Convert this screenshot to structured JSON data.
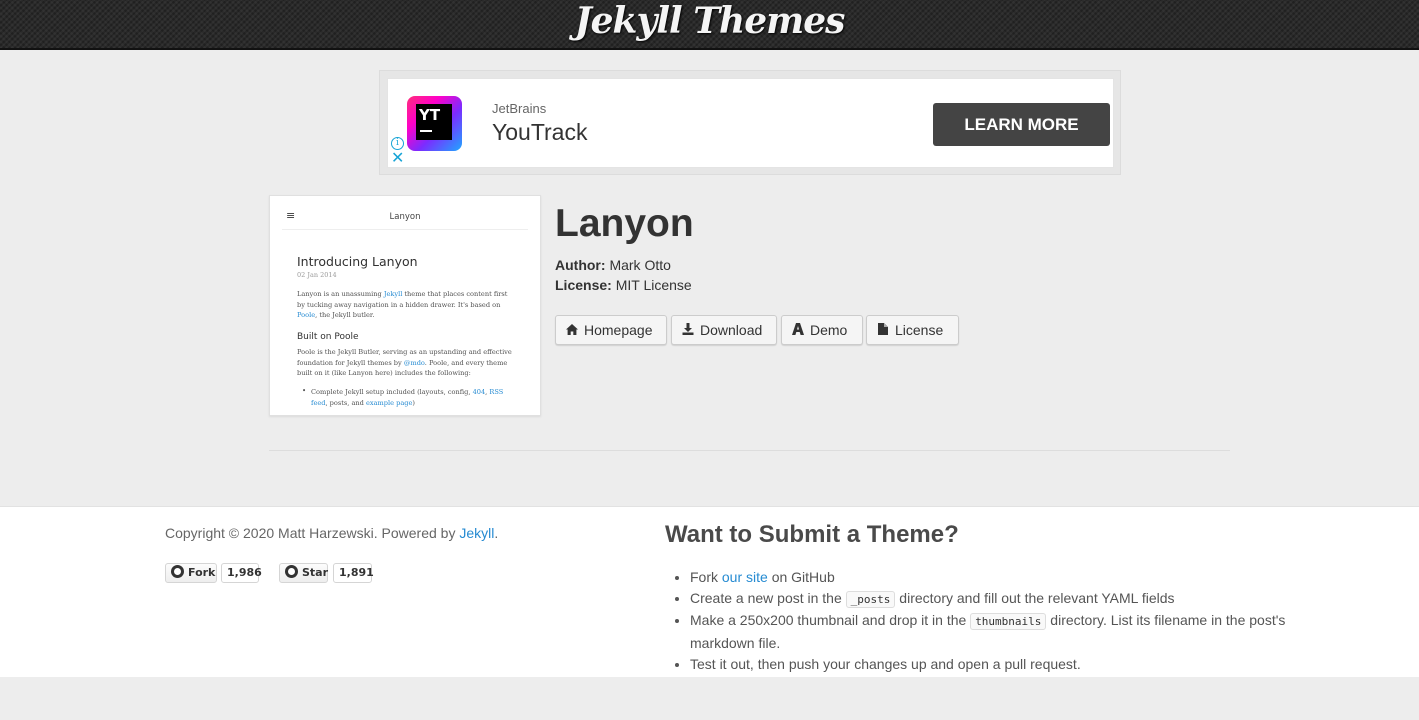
{
  "header": {
    "site_title": "Jekyll Themes"
  },
  "ad": {
    "brand": "JetBrains",
    "product": "YouTrack",
    "logo_text": "YT",
    "cta": "LEARN MORE",
    "info_glyph": "i",
    "close_glyph": "✕"
  },
  "thumbnail": {
    "menu_glyph": "≡",
    "site_name": "Lanyon",
    "post_title": "Introducing Lanyon",
    "post_date": "02 Jan 2014",
    "p1": {
      "pre": "Lanyon is an unassuming ",
      "link1": "Jekyll",
      "mid": " theme that places content first by tucking away navigation in a hidden drawer. It's based on ",
      "link2": "Poole",
      "post": ", the Jekyll butler."
    },
    "h2": "Built on Poole",
    "p2": {
      "pre": "Poole is the Jekyll Butler, serving as an upstanding and effective foundation for Jekyll themes by ",
      "link1": "@mdo",
      "post": ". Poole, and every theme built on it (like Lanyon here) includes the following:"
    },
    "li1": {
      "pre": "Complete Jekyll setup included (layouts, config, ",
      "link1": "404",
      "sep": ", ",
      "link2": "RSS feed",
      "mid": ", posts, and ",
      "link3": "example page",
      "post": ")"
    }
  },
  "theme": {
    "name": "Lanyon",
    "author_label": "Author:",
    "author": "Mark Otto",
    "license_label": "License:",
    "license": "MIT License",
    "buttons": {
      "homepage": "Homepage",
      "download": "Download",
      "demo": "Demo",
      "license": "License"
    },
    "icons": {
      "homepage": "home-icon",
      "download": "download-icon",
      "demo": "demo-icon",
      "license": "file-icon"
    }
  },
  "footer": {
    "copyright_pre": "Copyright © 2020 Matt Harzewski. Powered by ",
    "copyright_link": "Jekyll",
    "copyright_post": ".",
    "fork_label": "Fork",
    "fork_count": "1,986",
    "star_label": "Star",
    "star_count": "1,891",
    "submit_title": "Want to Submit a Theme?",
    "steps": [
      {
        "pre": "Fork ",
        "link": "our site",
        "post": " on GitHub"
      },
      {
        "pre": "Create a new post in the ",
        "code": "_posts",
        "post": " directory and fill out the relevant YAML fields"
      },
      {
        "pre": "Make a 250x200 thumbnail and drop it in the ",
        "code": "thumbnails",
        "post": " directory. List its filename in the post's markdown file."
      },
      {
        "text": "Test it out, then push your changes up and open a pull request."
      }
    ]
  },
  "colors": {
    "link": "#268bd2",
    "ad_button": "#444444",
    "header_bg": "#2b2b2b"
  }
}
